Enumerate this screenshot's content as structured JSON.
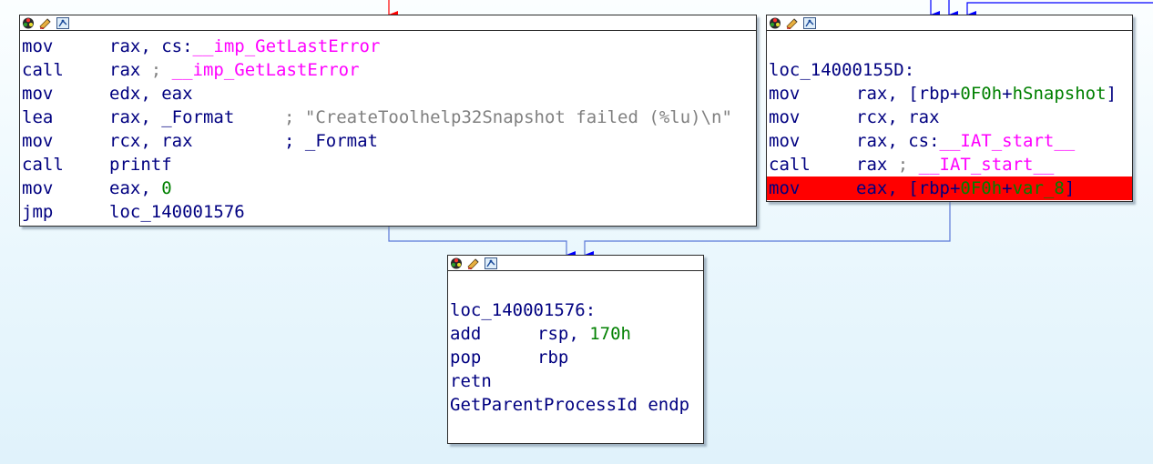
{
  "colors": {
    "edge_red": "#ff0000",
    "edge_blue": "#0000ff",
    "highlight_line": "#ff0000",
    "mnemonic": "#000080",
    "number": "#008000",
    "import_name": "#ff00ff",
    "comment_string": "#808080"
  },
  "header_icons": [
    "color-palette-icon",
    "rename-pencil-icon",
    "graph-overview-icon"
  ],
  "node_left": {
    "lines": [
      {
        "mn": "mov",
        "ops": [
          {
            "t": "rax, cs:"
          },
          {
            "t": "__imp_GetLastError",
            "c": "imp"
          }
        ]
      },
      {
        "mn": "call",
        "ops": [
          {
            "t": "rax "
          },
          {
            "t": "; ",
            "c": "semi"
          },
          {
            "t": "__imp_GetLastError",
            "c": "imp"
          }
        ]
      },
      {
        "mn": "mov",
        "ops": [
          {
            "t": "edx, eax"
          }
        ]
      },
      {
        "mn": "lea",
        "ops": [
          {
            "t": "rax, _Format"
          }
        ],
        "comment": [
          {
            "t": "; ",
            "c": "semi"
          },
          {
            "t": "\"CreateToolhelp32Snapshot failed (%lu)\\n\"",
            "c": "str"
          }
        ]
      },
      {
        "mn": "mov",
        "ops": [
          {
            "t": "rcx, rax"
          }
        ],
        "comment": [
          {
            "t": "; _Format",
            "c": "sym"
          }
        ]
      },
      {
        "mn": "call",
        "ops": [
          {
            "t": "printf"
          }
        ]
      },
      {
        "mn": "mov",
        "ops": [
          {
            "t": "eax, "
          },
          {
            "t": "0",
            "c": "num"
          }
        ]
      },
      {
        "mn": "jmp",
        "ops": [
          {
            "t": "loc_140001576"
          }
        ]
      }
    ]
  },
  "node_right": {
    "lines": [
      {
        "blank": true
      },
      {
        "label": "loc_14000155D:"
      },
      {
        "mn": "mov",
        "ops": [
          {
            "t": "rax, [rbp+"
          },
          {
            "t": "0F0h",
            "c": "num"
          },
          {
            "t": "+"
          },
          {
            "t": "hSnapshot",
            "c": "num"
          },
          {
            "t": "]"
          }
        ]
      },
      {
        "mn": "mov",
        "ops": [
          {
            "t": "rcx, rax"
          }
        ]
      },
      {
        "mn": "mov",
        "ops": [
          {
            "t": "rax, cs:"
          },
          {
            "t": "__IAT_start__",
            "c": "imp"
          }
        ]
      },
      {
        "mn": "call",
        "ops": [
          {
            "t": "rax "
          },
          {
            "t": "; ",
            "c": "semi"
          },
          {
            "t": "__IAT_start__",
            "c": "imp"
          }
        ]
      },
      {
        "mn": "mov",
        "ops": [
          {
            "t": "eax, [rbp+"
          },
          {
            "t": "0F0h",
            "c": "varnum"
          },
          {
            "t": "+"
          },
          {
            "t": "var_8",
            "c": "varnum"
          },
          {
            "t": "]"
          }
        ],
        "highlighted": true
      }
    ]
  },
  "node_bottom": {
    "lines": [
      {
        "blank": true
      },
      {
        "label": "loc_140001576:"
      },
      {
        "mn": "add",
        "ops": [
          {
            "t": "rsp, "
          },
          {
            "t": "170h",
            "c": "num"
          }
        ]
      },
      {
        "mn": "pop",
        "ops": [
          {
            "t": "rbp"
          }
        ]
      },
      {
        "mn": "retn",
        "ops": []
      },
      {
        "label": "GetParentProcessId endp"
      }
    ]
  }
}
